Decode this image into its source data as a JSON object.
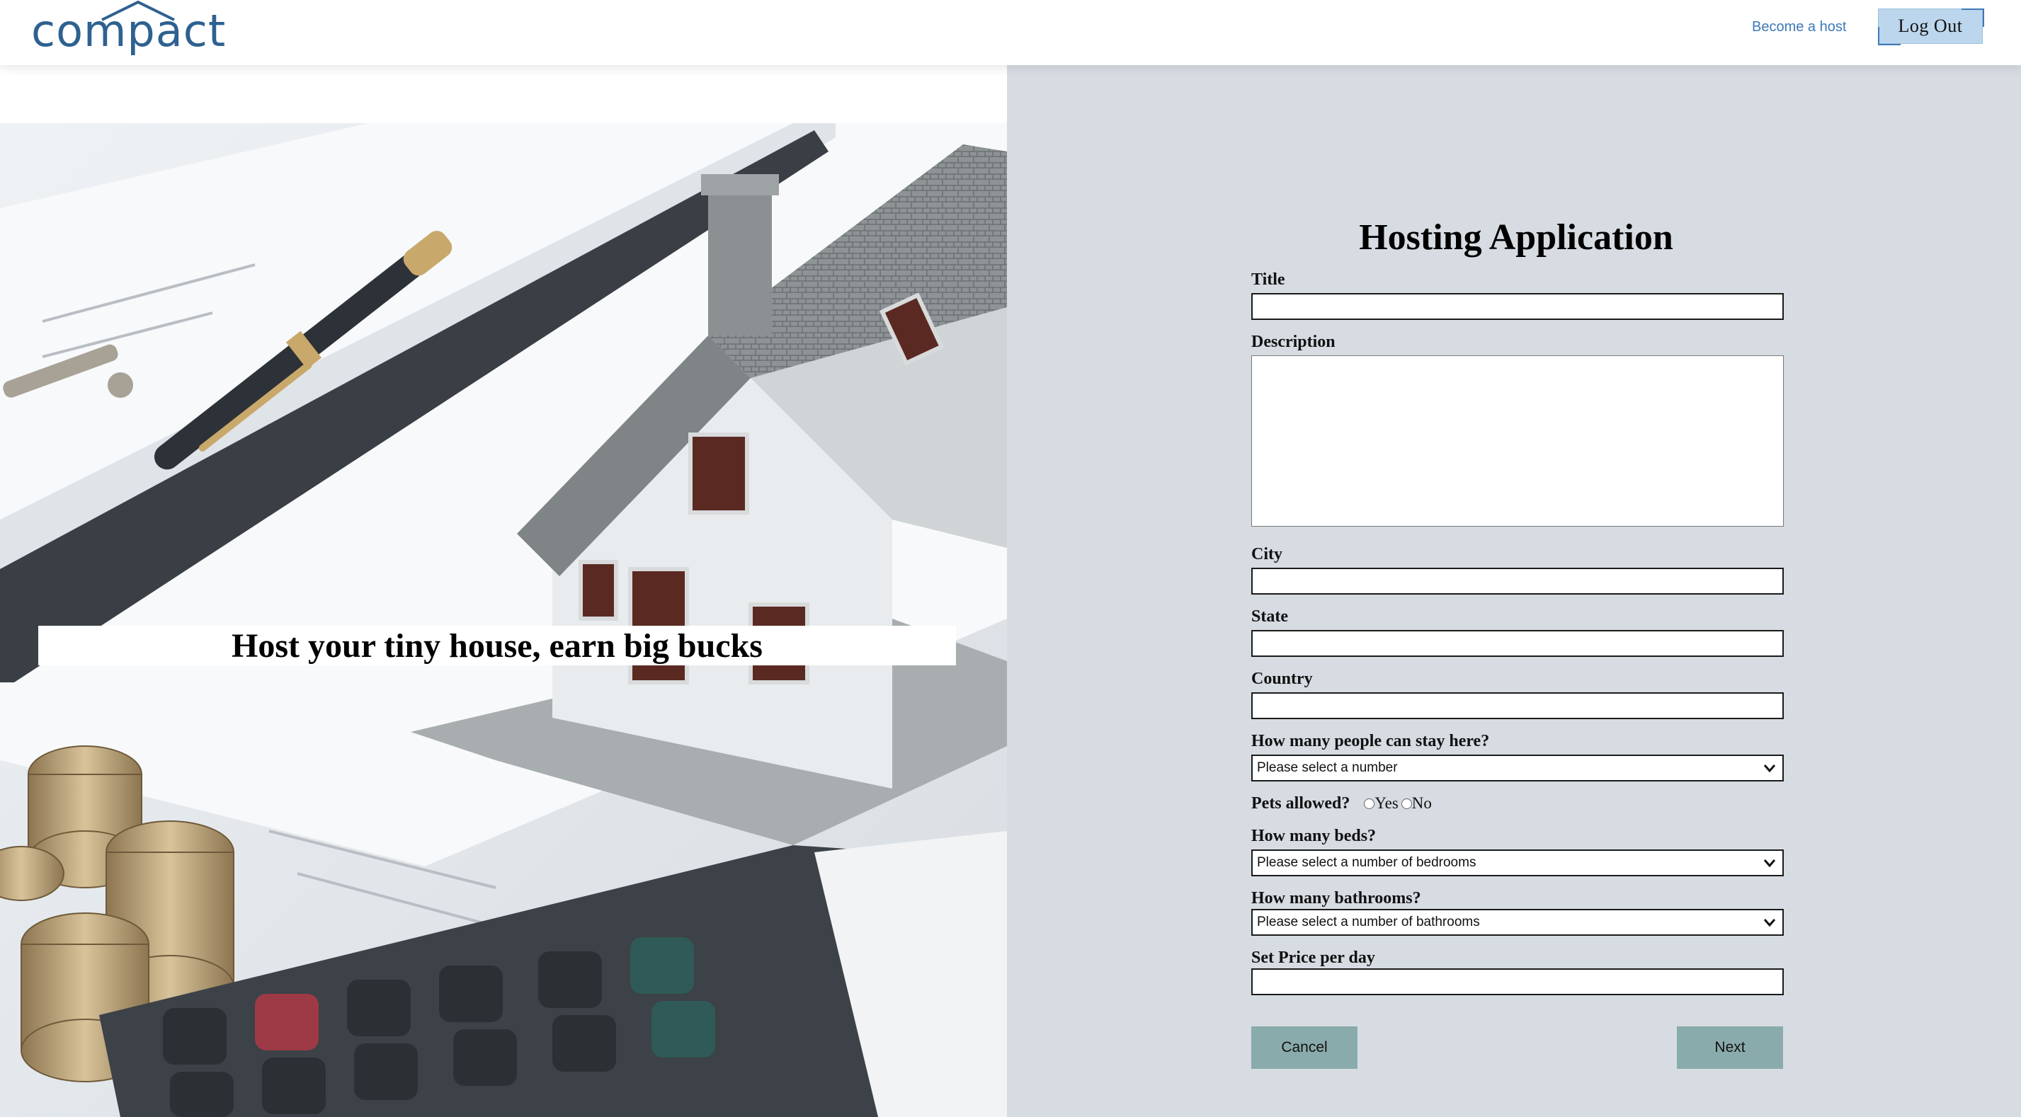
{
  "header": {
    "logo_text": "compact",
    "become_host": "Become a host",
    "logout": "Log Out"
  },
  "hero": {
    "tagline": "Host your tiny house, earn big bucks"
  },
  "form": {
    "title": "Hosting Application",
    "labels": {
      "title": "Title",
      "description": "Description",
      "city": "City",
      "state": "State",
      "country": "Country",
      "people": "How many people can stay here?",
      "pets": "Pets allowed?",
      "beds": "How many beds?",
      "bathrooms": "How many bathrooms?",
      "price": "Set Price per day"
    },
    "selects": {
      "people": "Please select a number",
      "beds": "Please select a number of bedrooms",
      "bathrooms": "Please select a number of bathrooms"
    },
    "pets_options": [
      "Yes",
      "No"
    ],
    "values": {
      "title": "",
      "description": "",
      "city": "",
      "state": "",
      "country": "",
      "price": ""
    },
    "buttons": {
      "cancel": "Cancel",
      "next": "Next"
    }
  },
  "colors": {
    "brand": "#2e6190",
    "link": "#3d7ab8",
    "panel_bg": "#d6dce2",
    "button_bg": "#8aabab",
    "logout_bg": "#bcd6ee"
  }
}
